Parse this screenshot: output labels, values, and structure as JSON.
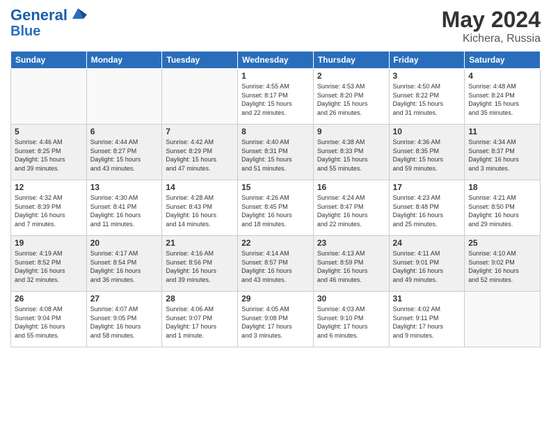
{
  "header": {
    "logo_line1": "General",
    "logo_line2": "Blue",
    "month_year": "May 2024",
    "location": "Kichera, Russia"
  },
  "weekdays": [
    "Sunday",
    "Monday",
    "Tuesday",
    "Wednesday",
    "Thursday",
    "Friday",
    "Saturday"
  ],
  "weeks": [
    [
      {
        "day": "",
        "info": ""
      },
      {
        "day": "",
        "info": ""
      },
      {
        "day": "",
        "info": ""
      },
      {
        "day": "1",
        "info": "Sunrise: 4:55 AM\nSunset: 8:17 PM\nDaylight: 15 hours\nand 22 minutes."
      },
      {
        "day": "2",
        "info": "Sunrise: 4:53 AM\nSunset: 8:20 PM\nDaylight: 15 hours\nand 26 minutes."
      },
      {
        "day": "3",
        "info": "Sunrise: 4:50 AM\nSunset: 8:22 PM\nDaylight: 15 hours\nand 31 minutes."
      },
      {
        "day": "4",
        "info": "Sunrise: 4:48 AM\nSunset: 8:24 PM\nDaylight: 15 hours\nand 35 minutes."
      }
    ],
    [
      {
        "day": "5",
        "info": "Sunrise: 4:46 AM\nSunset: 8:25 PM\nDaylight: 15 hours\nand 39 minutes."
      },
      {
        "day": "6",
        "info": "Sunrise: 4:44 AM\nSunset: 8:27 PM\nDaylight: 15 hours\nand 43 minutes."
      },
      {
        "day": "7",
        "info": "Sunrise: 4:42 AM\nSunset: 8:29 PM\nDaylight: 15 hours\nand 47 minutes."
      },
      {
        "day": "8",
        "info": "Sunrise: 4:40 AM\nSunset: 8:31 PM\nDaylight: 15 hours\nand 51 minutes."
      },
      {
        "day": "9",
        "info": "Sunrise: 4:38 AM\nSunset: 8:33 PM\nDaylight: 15 hours\nand 55 minutes."
      },
      {
        "day": "10",
        "info": "Sunrise: 4:36 AM\nSunset: 8:35 PM\nDaylight: 15 hours\nand 59 minutes."
      },
      {
        "day": "11",
        "info": "Sunrise: 4:34 AM\nSunset: 8:37 PM\nDaylight: 16 hours\nand 3 minutes."
      }
    ],
    [
      {
        "day": "12",
        "info": "Sunrise: 4:32 AM\nSunset: 8:39 PM\nDaylight: 16 hours\nand 7 minutes."
      },
      {
        "day": "13",
        "info": "Sunrise: 4:30 AM\nSunset: 8:41 PM\nDaylight: 16 hours\nand 11 minutes."
      },
      {
        "day": "14",
        "info": "Sunrise: 4:28 AM\nSunset: 8:43 PM\nDaylight: 16 hours\nand 14 minutes."
      },
      {
        "day": "15",
        "info": "Sunrise: 4:26 AM\nSunset: 8:45 PM\nDaylight: 16 hours\nand 18 minutes."
      },
      {
        "day": "16",
        "info": "Sunrise: 4:24 AM\nSunset: 8:47 PM\nDaylight: 16 hours\nand 22 minutes."
      },
      {
        "day": "17",
        "info": "Sunrise: 4:23 AM\nSunset: 8:48 PM\nDaylight: 16 hours\nand 25 minutes."
      },
      {
        "day": "18",
        "info": "Sunrise: 4:21 AM\nSunset: 8:50 PM\nDaylight: 16 hours\nand 29 minutes."
      }
    ],
    [
      {
        "day": "19",
        "info": "Sunrise: 4:19 AM\nSunset: 8:52 PM\nDaylight: 16 hours\nand 32 minutes."
      },
      {
        "day": "20",
        "info": "Sunrise: 4:17 AM\nSunset: 8:54 PM\nDaylight: 16 hours\nand 36 minutes."
      },
      {
        "day": "21",
        "info": "Sunrise: 4:16 AM\nSunset: 8:56 PM\nDaylight: 16 hours\nand 39 minutes."
      },
      {
        "day": "22",
        "info": "Sunrise: 4:14 AM\nSunset: 8:57 PM\nDaylight: 16 hours\nand 43 minutes."
      },
      {
        "day": "23",
        "info": "Sunrise: 4:13 AM\nSunset: 8:59 PM\nDaylight: 16 hours\nand 46 minutes."
      },
      {
        "day": "24",
        "info": "Sunrise: 4:11 AM\nSunset: 9:01 PM\nDaylight: 16 hours\nand 49 minutes."
      },
      {
        "day": "25",
        "info": "Sunrise: 4:10 AM\nSunset: 9:02 PM\nDaylight: 16 hours\nand 52 minutes."
      }
    ],
    [
      {
        "day": "26",
        "info": "Sunrise: 4:08 AM\nSunset: 9:04 PM\nDaylight: 16 hours\nand 55 minutes."
      },
      {
        "day": "27",
        "info": "Sunrise: 4:07 AM\nSunset: 9:05 PM\nDaylight: 16 hours\nand 58 minutes."
      },
      {
        "day": "28",
        "info": "Sunrise: 4:06 AM\nSunset: 9:07 PM\nDaylight: 17 hours\nand 1 minute."
      },
      {
        "day": "29",
        "info": "Sunrise: 4:05 AM\nSunset: 9:08 PM\nDaylight: 17 hours\nand 3 minutes."
      },
      {
        "day": "30",
        "info": "Sunrise: 4:03 AM\nSunset: 9:10 PM\nDaylight: 17 hours\nand 6 minutes."
      },
      {
        "day": "31",
        "info": "Sunrise: 4:02 AM\nSunset: 9:11 PM\nDaylight: 17 hours\nand 9 minutes."
      },
      {
        "day": "",
        "info": ""
      }
    ]
  ]
}
